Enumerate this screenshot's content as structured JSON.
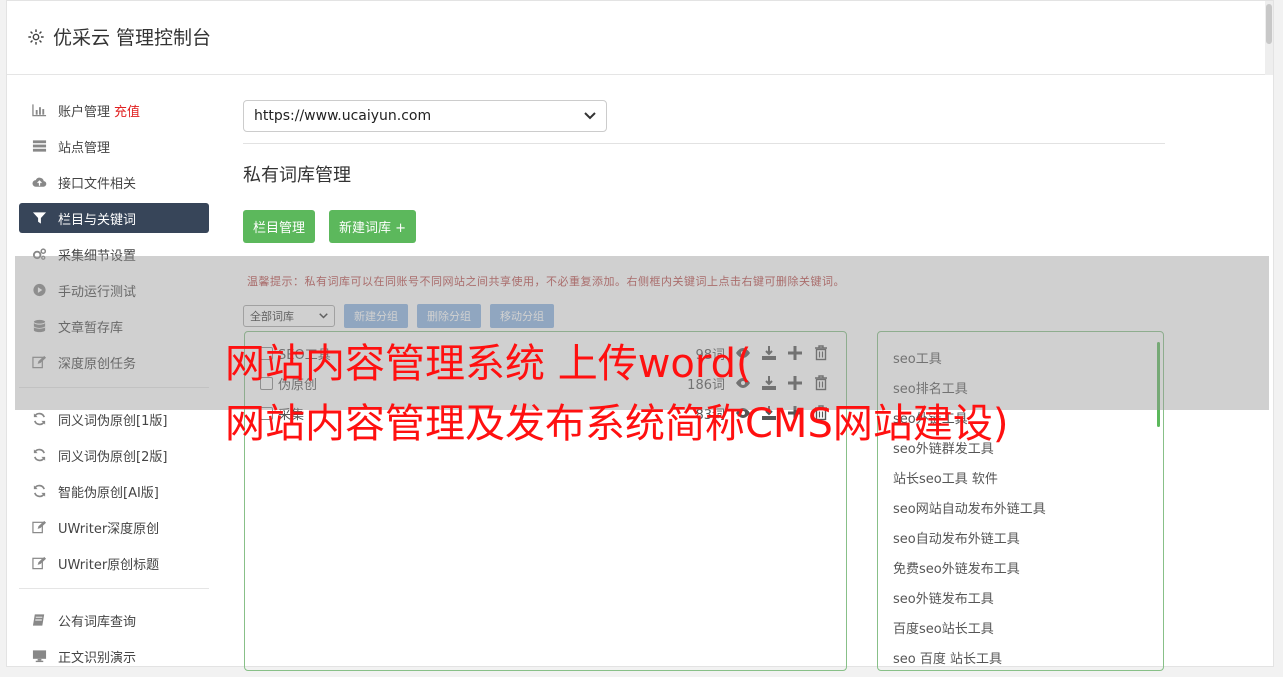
{
  "brand": {
    "title": "优采云 管理控制台",
    "icon": "gear-icon"
  },
  "sidebar": {
    "group1": [
      {
        "label": "账户管理",
        "badge": "充值",
        "icon": "bar-chart-icon"
      },
      {
        "label": "站点管理",
        "icon": "server-icon"
      },
      {
        "label": "接口文件相关",
        "icon": "cloud-upload-icon"
      },
      {
        "label": "栏目与关键词",
        "icon": "filter-icon",
        "active": true
      },
      {
        "label": "采集细节设置",
        "icon": "gears-icon"
      },
      {
        "label": "手动运行测试",
        "icon": "play-circle-icon"
      },
      {
        "label": "文章暂存库",
        "icon": "database-icon"
      },
      {
        "label": "深度原创任务",
        "icon": "edit-icon"
      }
    ],
    "group2": [
      {
        "label": "同义词伪原创[1版]",
        "icon": "refresh-icon"
      },
      {
        "label": "同义词伪原创[2版]",
        "icon": "refresh-icon"
      },
      {
        "label": "智能伪原创[AI版]",
        "icon": "refresh-icon"
      },
      {
        "label": "UWriter深度原创",
        "icon": "edit-icon"
      },
      {
        "label": "UWriter原创标题",
        "icon": "edit-icon"
      }
    ],
    "group3": [
      {
        "label": "公有词库查询",
        "icon": "book-icon"
      },
      {
        "label": "正文识别演示",
        "icon": "monitor-icon"
      }
    ]
  },
  "main": {
    "site_select": "https://www.ucaiyun.com",
    "title": "私有词库管理",
    "btn_columns": "栏目管理",
    "btn_new_lib": "新建词库 +",
    "tip": "温馨提示：私有词库可以在同账号不同网站之间共享使用，不必重复添加。右侧框内关键词上点击右键可删除关键词。",
    "filter_select": "全部词库",
    "btn_new_group": "新建分组",
    "btn_delete_group": "删除分组",
    "btn_move_group": "移动分组"
  },
  "libraries": [
    {
      "name": "SEO工具",
      "count": "98词"
    },
    {
      "name": "伪原创",
      "count": "186词"
    },
    {
      "name": "采集",
      "count": "83词"
    }
  ],
  "keywords": [
    "seo工具",
    "seo排名工具",
    "seo外链工具",
    "seo外链群发工具",
    "站长seo工具 软件",
    "seo网站自动发布外链工具",
    "seo自动发布外链工具",
    "免费seo外链发布工具",
    "seo外链发布工具",
    "百度seo站长工具",
    "seo 百度 站长工具"
  ],
  "overlay_title": {
    "line1": "网站内容管理系统 上传word(",
    "line2": "网站内容管理及发布系统简称CMS网站建设)"
  },
  "colors": {
    "active_nav": "#374559",
    "green": "#5cb85c",
    "blue_btn": "#8ab3e2",
    "overlay_text": "#ff1010"
  }
}
